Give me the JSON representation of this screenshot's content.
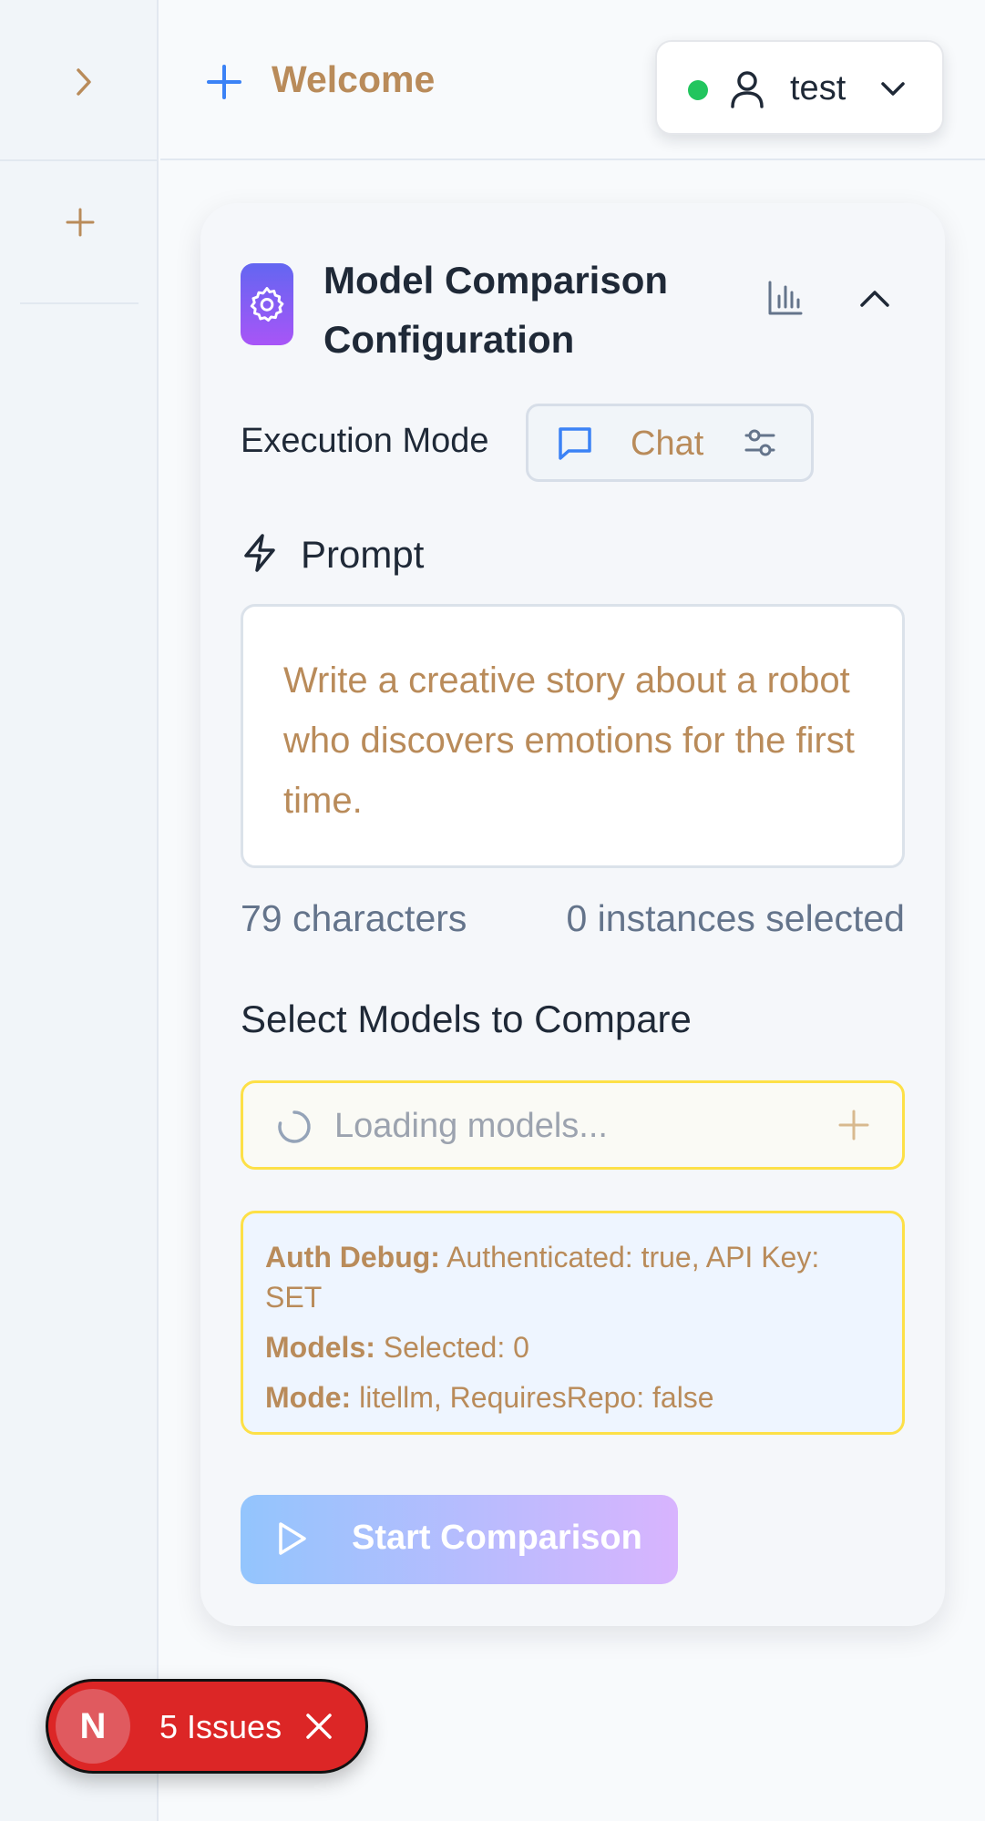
{
  "sidebar": {
    "toggle_icon": "chevron-right-icon",
    "new_icon": "plus-icon"
  },
  "header": {
    "title": "Welcome",
    "new_icon": "plus-icon",
    "user": {
      "name": "test",
      "status_color": "#22c55e"
    }
  },
  "config": {
    "title": "Model Comparison Configuration",
    "execution_mode_label": "Execution Mode",
    "mode": "Chat",
    "prompt_label": "Prompt",
    "prompt_text": "Write a creative story about a robot who discovers emotions for the first time.",
    "char_count": "79 characters",
    "instances_selected": "0 instances selected",
    "select_models_title": "Select Models to Compare",
    "models_placeholder": "Loading models...",
    "debug": {
      "auth_label": "Auth Debug:",
      "auth_value": " Authenticated: true, API Key: SET",
      "models_label": "Models:",
      "models_value": " Selected: 0",
      "mode_label": "Mode:",
      "mode_value": " litellm, RequiresRepo: false"
    },
    "start_button": "Start Comparison"
  },
  "issues": {
    "badge_letter": "N",
    "label": "5 Issues"
  },
  "colors": {
    "accent_text": "#b98b5a",
    "primary_blue": "#3b82f6",
    "gradient_start": "#6366f1",
    "gradient_end": "#a855f7",
    "warning_border": "#fde047",
    "issues_red": "#dc2626"
  }
}
